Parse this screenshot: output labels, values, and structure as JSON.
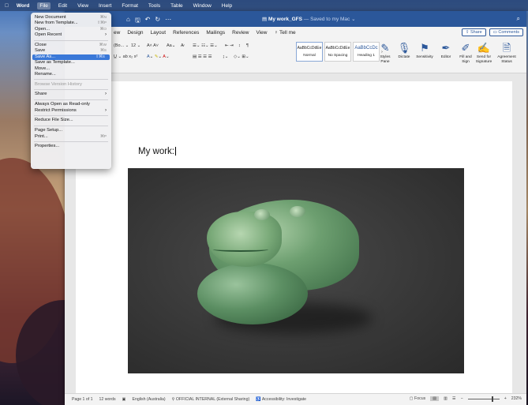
{
  "menubar": {
    "items": [
      {
        "label": "Word"
      },
      {
        "label": "File"
      },
      {
        "label": "Edit"
      },
      {
        "label": "View"
      },
      {
        "label": "Insert"
      },
      {
        "label": "Format"
      },
      {
        "label": "Tools"
      },
      {
        "label": "Table"
      },
      {
        "label": "Window"
      },
      {
        "label": "Help"
      }
    ]
  },
  "title_bar": {
    "document_name": "My work_GFS",
    "status": " — Saved to my Mac ⌄"
  },
  "ribbon_tabs": [
    "ew",
    "Design",
    "Layout",
    "References",
    "Mailings",
    "Review",
    "View",
    "Tell me"
  ],
  "ribbon_actions": {
    "share": "Share",
    "comments": "Comments"
  },
  "ribbon": {
    "font_name": "(Bo...",
    "font_size": "12",
    "styles": [
      {
        "preview": "AaBbCcDdEe",
        "label": "Normal"
      },
      {
        "preview": "AaBbCcDdEe",
        "label": "No Spacing"
      },
      {
        "preview": "AaBbCcDc",
        "label": "Heading 1"
      }
    ],
    "tools": [
      {
        "label": "Styles Pane"
      },
      {
        "label": "Dictate"
      },
      {
        "label": "Sensitivity"
      },
      {
        "label": "Editor"
      },
      {
        "label": "Fill and Sign"
      },
      {
        "label": "Send for Signature"
      },
      {
        "label": "Agreement Status"
      }
    ]
  },
  "document": {
    "heading": "My work:"
  },
  "status_bar": {
    "page": "Page 1 of 1",
    "words": "12 words",
    "language": "English (Australia)",
    "classification": "OFFICIAL INTERNAL (External Sharing)",
    "accessibility": "Accessibility: Investigate",
    "focus": "Focus",
    "zoom": "232%"
  },
  "file_menu": {
    "items": [
      {
        "label": "New Document",
        "shortcut": "⌘N"
      },
      {
        "label": "New from Template...",
        "shortcut": "⇧⌘P"
      },
      {
        "label": "Open...",
        "shortcut": "⌘O"
      },
      {
        "label": "Open Recent"
      },
      {
        "label": "Close",
        "shortcut": "⌘W"
      },
      {
        "label": "Save",
        "shortcut": "⌘S"
      },
      {
        "label": "Save As...",
        "shortcut": "⇧⌘S"
      },
      {
        "label": "Save as Template..."
      },
      {
        "label": "Move..."
      },
      {
        "label": "Rename..."
      },
      {
        "label": "Browse Version History"
      },
      {
        "label": "Share"
      },
      {
        "label": "Always Open as Read-only"
      },
      {
        "label": "Restrict Permissions"
      },
      {
        "label": "Reduce File Size..."
      },
      {
        "label": "Page Setup..."
      },
      {
        "label": "Print...",
        "shortcut": "⌘P"
      },
      {
        "label": "Properties..."
      }
    ],
    "highlighted": "Save As..."
  },
  "colors": {
    "accent": "#2b579a",
    "menu_highlight": "#3a78d8"
  }
}
